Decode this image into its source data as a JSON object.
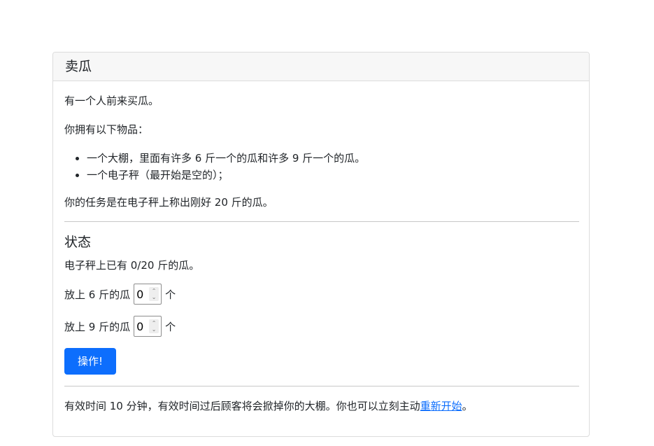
{
  "card": {
    "title": "卖瓜"
  },
  "intro": {
    "line1": "有一个人前来买瓜。",
    "line2": "你拥有以下物品：",
    "items": [
      "一个大棚，里面有许多 6 斤一个的瓜和许多 9 斤一个的瓜。",
      "一个电子秤（最开始是空的）；"
    ],
    "task": "你的任务是在电子秤上称出刚好 20 斤的瓜。"
  },
  "status": {
    "heading": "状态",
    "scale_text": "电子秤上已有 0/20 斤的瓜。",
    "row6_label": "放上 6 斤的瓜",
    "row6_value": "0",
    "row6_unit": "个",
    "row9_label": "放上 9 斤的瓜",
    "row9_value": "0",
    "row9_unit": "个",
    "button_label": "操作!"
  },
  "footer": {
    "text": "有效时间 10 分钟，有效时间过后顾客将会掀掉你的大棚。你也可以立刻主动",
    "link_text": "重新开始",
    "tail": "。"
  }
}
